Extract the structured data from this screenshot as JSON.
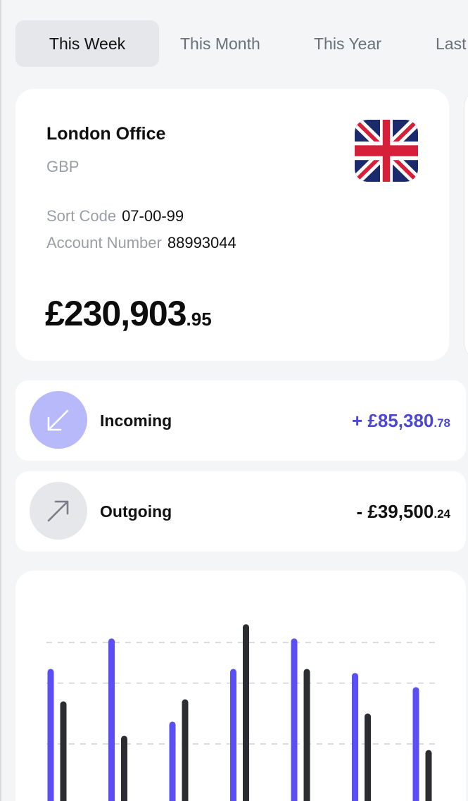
{
  "tabs": [
    {
      "label": "This Week",
      "active": true
    },
    {
      "label": "This Month",
      "active": false
    },
    {
      "label": "This Year",
      "active": false
    },
    {
      "label": "Last",
      "active": false
    }
  ],
  "account": {
    "name": "London Office",
    "currency": "GBP",
    "flag_icon": "uk-flag-icon",
    "sort_code_label": "Sort Code",
    "sort_code": "07-00-99",
    "account_number_label": "Account Number",
    "account_number": "88993044",
    "balance_main": "£230,903",
    "balance_cents": ".95"
  },
  "incoming": {
    "label": "Incoming",
    "icon": "arrow-down-left-icon",
    "amount_main": "+ £85,380",
    "amount_cents": ".78",
    "color": "#4b46d6"
  },
  "outgoing": {
    "label": "Outgoing",
    "icon": "arrow-up-right-icon",
    "amount_main": "- £39,500",
    "amount_cents": ".24",
    "color": "#111111"
  },
  "chart_data": {
    "type": "bar",
    "grid": true,
    "ylim": [
      0,
      100
    ],
    "gridlines": [
      25,
      55,
      75
    ],
    "series": [
      {
        "color": "#5a4ff5",
        "values": [
          62,
          77,
          36,
          62,
          77,
          60,
          53
        ]
      },
      {
        "color": "#2b2d33",
        "values": [
          46,
          29,
          47,
          84,
          62,
          40,
          22
        ]
      }
    ]
  }
}
